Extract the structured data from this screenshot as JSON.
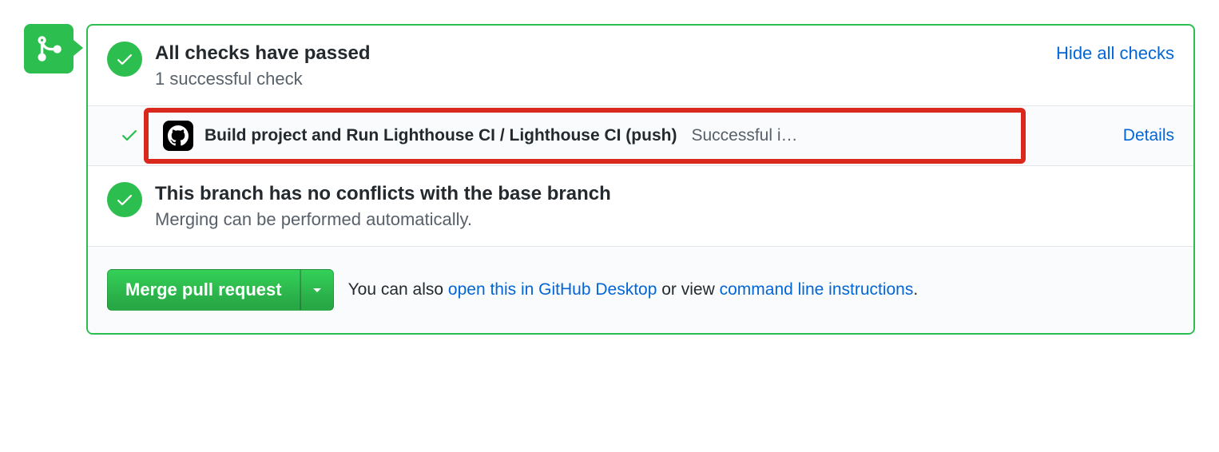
{
  "checks": {
    "title": "All checks have passed",
    "subtitle": "1 successful check",
    "toggle_label": "Hide all checks",
    "items": [
      {
        "name": "Build project and Run Lighthouse CI / Lighthouse CI (push)",
        "status": "Successful i…",
        "details_label": "Details"
      }
    ]
  },
  "conflicts": {
    "title": "This branch has no conflicts with the base branch",
    "subtitle": "Merging can be performed automatically."
  },
  "merge": {
    "button_label": "Merge pull request",
    "prefix": "You can also ",
    "link_desktop": "open this in GitHub Desktop",
    "mid": " or view ",
    "link_cli": "command line instructions",
    "suffix": "."
  }
}
